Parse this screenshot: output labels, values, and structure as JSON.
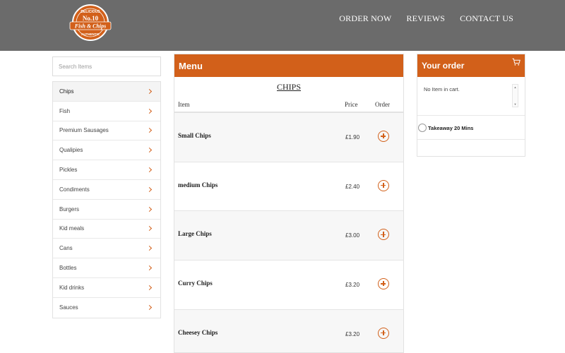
{
  "nav": {
    "items": [
      "ORDER NOW",
      "REVIEWS",
      "CONTACT US"
    ]
  },
  "logo": {
    "name": "No.10 Fish & Chips",
    "alt_text": [
      "DELICIOUS",
      "No.10",
      "Fish & Chips",
      "AUTHENTIC"
    ]
  },
  "search": {
    "placeholder": "Search Items"
  },
  "categories": [
    {
      "label": "Chips",
      "active": true
    },
    {
      "label": "Fish"
    },
    {
      "label": "Premium Sausages"
    },
    {
      "label": "Qualipies"
    },
    {
      "label": "Pickles"
    },
    {
      "label": "Condiments"
    },
    {
      "label": "Burgers"
    },
    {
      "label": "Kid meals"
    },
    {
      "label": "Cans"
    },
    {
      "label": "Bottles"
    },
    {
      "label": "Kid drinks"
    },
    {
      "label": "Sauces"
    }
  ],
  "menu": {
    "heading": "Menu",
    "section_title": "CHIPS",
    "columns": {
      "item": "Item",
      "price": "Price",
      "order": "Order"
    },
    "items": [
      {
        "name": "Small Chips",
        "price": "£1.90"
      },
      {
        "name": "medium Chips",
        "price": "£2.40"
      },
      {
        "name": "Large Chips",
        "price": "£3.00"
      },
      {
        "name": "Curry Chips",
        "price": "£3.20"
      },
      {
        "name": "Cheesey Chips",
        "price": "£3.20"
      }
    ]
  },
  "order": {
    "heading": "Your order",
    "empty_text": "No Item in cart.",
    "takeaway_label": "Takeaway 20 Mins"
  },
  "colors": {
    "accent": "#d2601a",
    "header_bg": "#6b6b6b"
  },
  "icons": {
    "cart": "cart-icon",
    "add": "plus-circle-icon",
    "chevron": "chevron-right-icon"
  }
}
